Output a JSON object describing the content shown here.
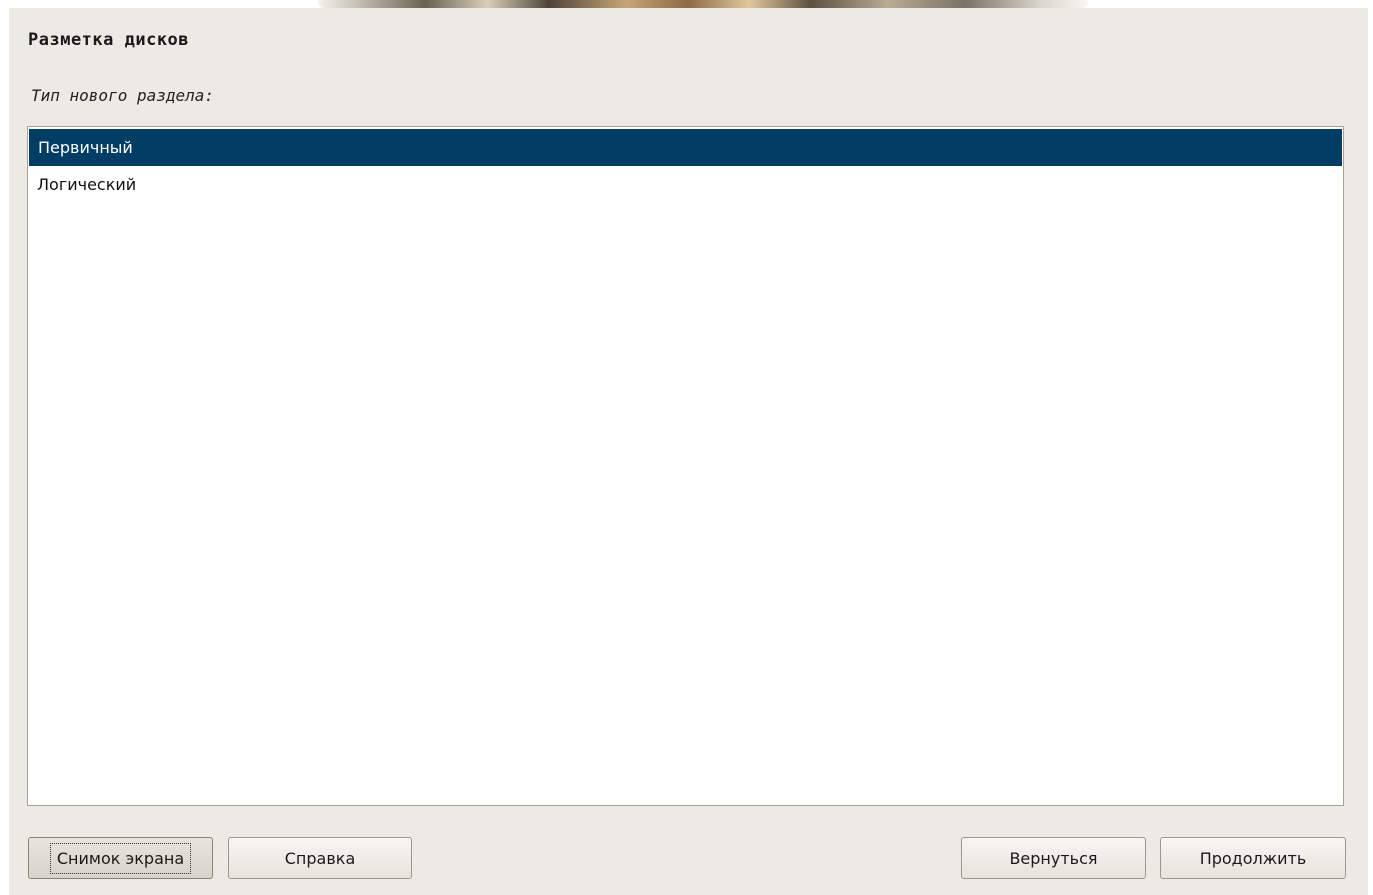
{
  "header": {
    "title": "Разметка дисков"
  },
  "prompt": {
    "question": "Тип нового раздела:"
  },
  "partition_types": {
    "selected_index": 0,
    "options": [
      {
        "label": "Первичный",
        "selected": true
      },
      {
        "label": "Логический",
        "selected": false
      }
    ]
  },
  "buttons": {
    "screenshot_label": "Снимок экрана",
    "help_label": "Справка",
    "back_label": "Вернуться",
    "continue_label": "Продолжить"
  },
  "colors": {
    "selection": "#023d66",
    "panel_background": "#edeae5"
  }
}
